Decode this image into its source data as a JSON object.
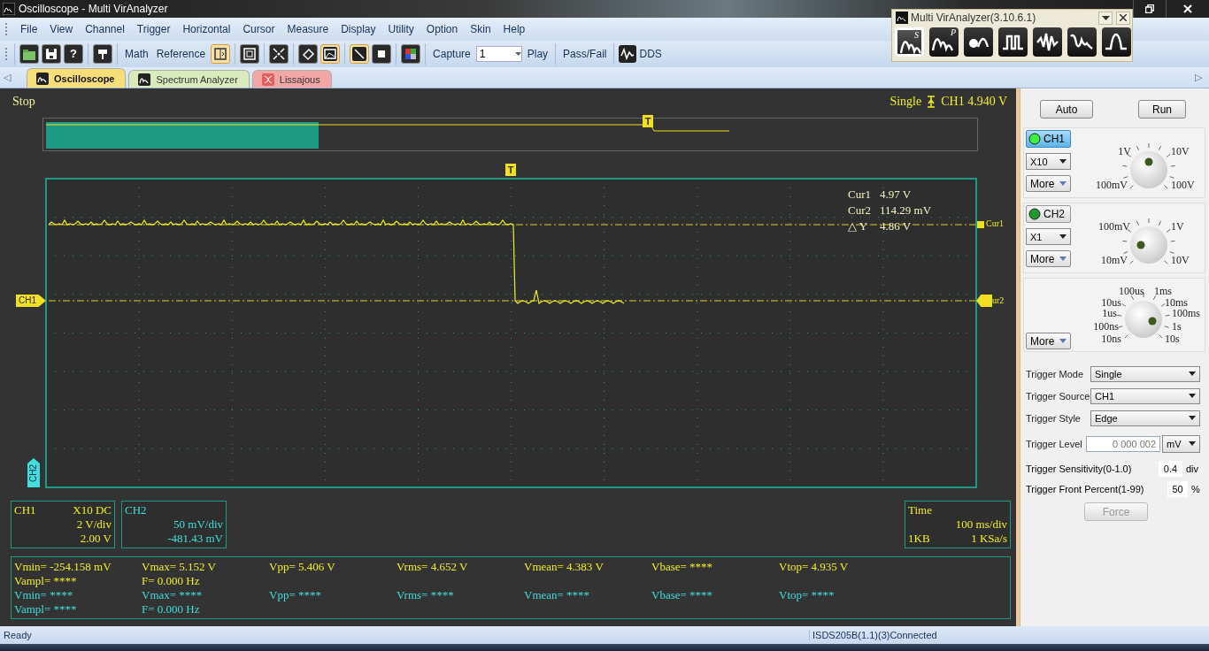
{
  "window": {
    "title": "Oscilloscope - Multi VirAnalyzer"
  },
  "menu": [
    "File",
    "View",
    "Channel",
    "Trigger",
    "Horizontal",
    "Cursor",
    "Measure",
    "Display",
    "Utility",
    "Option",
    "Skin",
    "Help"
  ],
  "toolbar": {
    "groups": [
      [
        {
          "kind": "icon",
          "pressed": false
        },
        {
          "kind": "icon",
          "pressed": false
        },
        {
          "kind": "icon",
          "pressed": false,
          "glyph": "?"
        }
      ],
      [
        {
          "kind": "icon",
          "pressed": false
        }
      ],
      [
        {
          "kind": "text",
          "label": "Math"
        },
        {
          "kind": "text",
          "label": "Reference"
        },
        {
          "kind": "icon",
          "pressed": true
        }
      ],
      [
        {
          "kind": "icon",
          "pressed": false
        }
      ],
      [
        {
          "kind": "icon",
          "pressed": false
        }
      ],
      [
        {
          "kind": "icon",
          "pressed": false
        },
        {
          "kind": "icon",
          "pressed": true
        }
      ],
      [
        {
          "kind": "icon",
          "pressed": true
        },
        {
          "kind": "icon",
          "pressed": false
        }
      ],
      [
        {
          "kind": "icon",
          "pressed": false
        }
      ],
      [
        {
          "kind": "label",
          "label": "Capture"
        },
        {
          "kind": "select",
          "value": "1"
        },
        {
          "kind": "text",
          "label": "Play"
        }
      ],
      [
        {
          "kind": "text",
          "label": "Pass/Fail"
        }
      ],
      [
        {
          "kind": "icontext",
          "label": "DDS"
        }
      ]
    ]
  },
  "tabs": {
    "scroll_left": "◁",
    "scroll_right": "▷",
    "items": [
      {
        "label": "Oscilloscope",
        "selected": true,
        "color": "#f7de78"
      },
      {
        "label": "Spectrum Analyzer",
        "selected": false,
        "color": "#d9ebbd"
      },
      {
        "label": "Lissajous",
        "selected": false,
        "color": "#f2a6a6"
      }
    ]
  },
  "analyzer_window": {
    "title": "Multi VirAnalyzer(3.10.6.1)",
    "tools": [
      {
        "selected": true,
        "glyph": "S"
      },
      {
        "selected": false,
        "glyph": "P"
      },
      {
        "selected": false
      },
      {
        "selected": false
      },
      {
        "selected": false
      },
      {
        "selected": false
      },
      {
        "selected": false
      }
    ]
  },
  "scope": {
    "state": "Stop",
    "trigger_mode": "Single",
    "trigger_readout": "CH1 4.940 V",
    "trigger_marker": "T",
    "overview_trigger_marker": "T",
    "ch1_marker": "CH1",
    "ch2_marker": "CH2",
    "cursor_1_label": "Cur1",
    "cursor_2_label": "ur2",
    "cursor_readouts": [
      {
        "label": "Cur1",
        "value": "4.97 V"
      },
      {
        "label": "Cur2",
        "value": "114.29 mV"
      },
      {
        "label": "△ Y",
        "value": "4.86 V"
      }
    ],
    "info_boxes": [
      {
        "color": "#f0f020",
        "title": "CH1",
        "tag": "X10  DC",
        "lines": [
          {
            "value": "2 V/div"
          },
          {
            "value": "2.00 V"
          }
        ]
      },
      {
        "color": "#40dede",
        "title": "CH2",
        "lines": [
          {
            "value": "50 mV/div"
          },
          {
            "value": "-481.43 mV"
          }
        ]
      },
      {
        "color": "#f0f020",
        "title": "Time",
        "lines": [
          {
            "value": "100 ms/div"
          },
          {
            "label": "1KB",
            "value": "1 KSa/s"
          }
        ]
      }
    ],
    "measurements": [
      {
        "color": "#f0f020",
        "rows": [
          [
            "Vmin= -254.158 mV",
            "Vmax= 5.152 V",
            "Vpp= 5.406 V",
            "Vrms= 4.652 V",
            "Vmean= 4.383 V",
            "Vbase= ****",
            "Vtop= 4.935 V"
          ],
          [
            "Vampl= ****",
            "F= 0.000 Hz"
          ]
        ]
      },
      {
        "color": "#40dede",
        "rows": [
          [
            "Vmin= ****",
            "Vmax= ****",
            "Vpp= ****",
            "Vrms= ****",
            "Vmean= ****",
            "Vbase= ****",
            "Vtop= ****"
          ],
          [
            "Vampl= ****",
            "F= 0.000 Hz"
          ]
        ]
      }
    ]
  },
  "controls": {
    "auto": "Auto",
    "run": "Run",
    "channels": [
      {
        "label": "CH1",
        "selected": true,
        "probe": "X10",
        "more": "More",
        "dial_labels": [
          "1V",
          "10V",
          "100mV",
          "100V"
        ]
      },
      {
        "label": "CH2",
        "selected": false,
        "probe": "X1",
        "more": "More",
        "dial_labels": [
          "100mV",
          "1V",
          "10mV",
          "10V"
        ]
      }
    ],
    "timebase": {
      "more": "More",
      "dial_labels": [
        "100us",
        "1ms",
        "10us",
        "10ms",
        "1us",
        "100ms",
        "100ns",
        "1s",
        "10ns",
        "10s"
      ]
    },
    "trigger": {
      "mode_label": "Trigger Mode",
      "mode": "Single",
      "source_label": "Trigger Source",
      "source": "CH1",
      "style_label": "Trigger Style",
      "style": "Edge",
      "level_label": "Trigger Level",
      "level": "0 000 002",
      "level_unit": "mV",
      "sensitivity_label": "Trigger Sensitivity(0-1.0)",
      "sensitivity": "0.4",
      "sensitivity_unit": "div",
      "front_label": "Trigger Front Percent(1-99)",
      "front": "50",
      "front_unit": "%",
      "force": "Force",
      "force_disabled": true
    }
  },
  "status_bar": {
    "left": "Ready",
    "right": "ISDS205B(1.1)(3)Connected"
  }
}
